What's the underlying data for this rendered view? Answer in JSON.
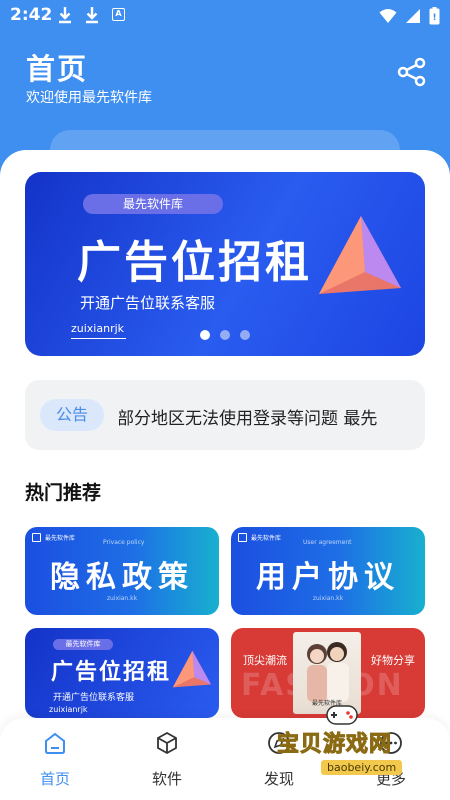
{
  "status_bar": {
    "time": "2:42",
    "a_label": "A"
  },
  "header": {
    "title": "首页",
    "subtitle": "欢迎使用最先软件库"
  },
  "banner": {
    "tag": "最先软件库",
    "title": "广告位招租",
    "subtitle": "开通广告位联系客服",
    "brand": "zuixianrjk",
    "page_count": 3,
    "active_index": 0
  },
  "notice": {
    "badge": "公告",
    "text": "部分地区无法使用登录等问题   最先"
  },
  "section": {
    "title": "热门推荐"
  },
  "cards": {
    "privacy": {
      "logo": "最先软件库",
      "en": "Privace policy",
      "title": "隐私政策",
      "small": "zuixian.kk"
    },
    "agreement": {
      "logo": "最先软件库",
      "en": "User agreement",
      "title": "用户协议",
      "small": "zuixian.kk"
    },
    "ad": {
      "tag": "最先软件库",
      "title": "广告位招租",
      "subtitle": "开通广告位联系客服",
      "brand": "zuixianrjk"
    },
    "fashion": {
      "left": "顶尖潮流",
      "right": "好物分享",
      "bg": "FASHION",
      "caption": "最先软件库"
    }
  },
  "tabbar": {
    "items": [
      {
        "label": "首页",
        "icon": "home-icon"
      },
      {
        "label": "软件",
        "icon": "cube-icon"
      },
      {
        "label": "发现",
        "icon": "compass-icon"
      },
      {
        "label": "更多",
        "icon": "more-icon"
      }
    ],
    "active": 0
  },
  "watermark": {
    "text": "宝贝游戏网",
    "url": "baobeiy.com"
  },
  "colors": {
    "primary": "#3f8ff0",
    "banner_blue": "#1d45e2",
    "notice_badge_bg": "#dbe8fb",
    "fashion_red": "#d83a36"
  }
}
